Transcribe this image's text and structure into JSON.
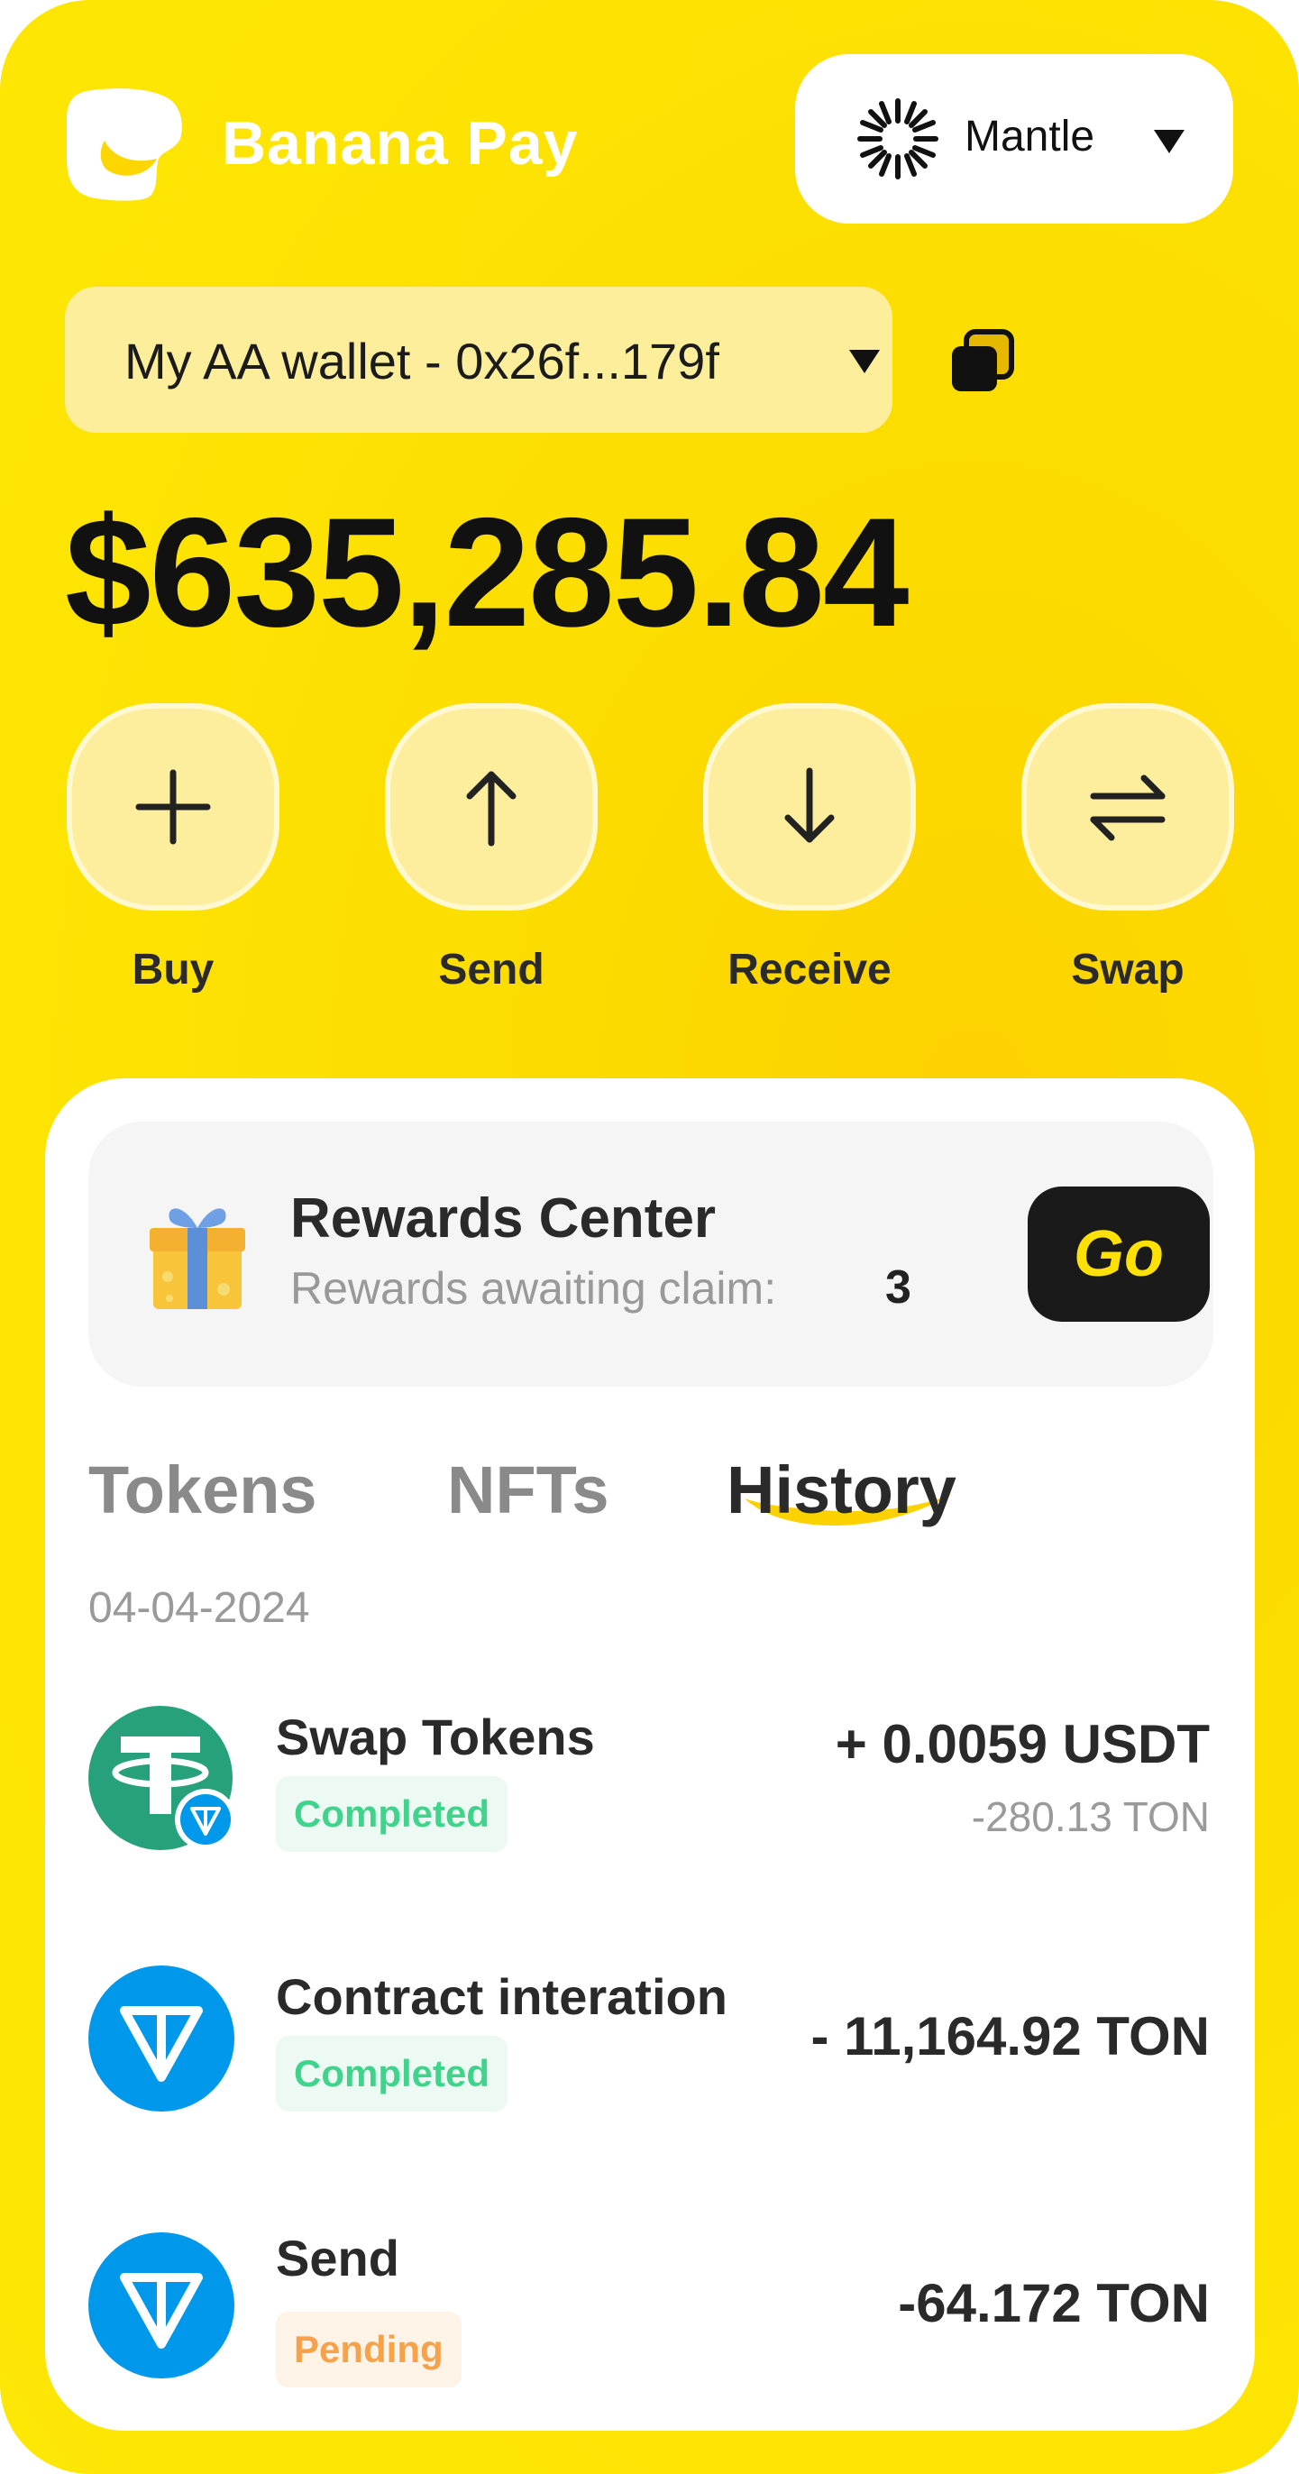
{
  "header": {
    "brand": "Banana Pay",
    "network": "Mantle",
    "wallet_label": "My AA wallet - 0x26f...179f"
  },
  "balance": "$635,285.84",
  "actions": [
    {
      "label": "Buy",
      "icon": "plus-icon"
    },
    {
      "label": "Send",
      "icon": "arrow-up-icon"
    },
    {
      "label": "Receive",
      "icon": "arrow-down-icon"
    },
    {
      "label": "Swap",
      "icon": "swap-arrows-icon"
    }
  ],
  "rewards": {
    "title": "Rewards Center",
    "subtitle": "Rewards awaiting claim:",
    "count": "3",
    "button": "Go"
  },
  "tabs": [
    "Tokens",
    "NFTs",
    "History"
  ],
  "active_tab": "History",
  "history": {
    "date": "04-04-2024",
    "items": [
      {
        "title": "Swap Tokens",
        "status": "Completed",
        "amount": "+ 0.0059 USDT",
        "subamount": "-280.13 TON",
        "icon": "usdt-ton-icon"
      },
      {
        "title": "Contract interation",
        "status": "Completed",
        "amount": "- 11,164.92 TON",
        "icon": "ton-icon"
      },
      {
        "title": "Send",
        "status": "Pending",
        "amount": "-64.172 TON",
        "icon": "ton-icon"
      }
    ]
  },
  "colors": {
    "brand_yellow": "#fde105",
    "completed": "#3fd38c",
    "pending": "#f5a24a",
    "ton_blue": "#0098ea",
    "usdt_green": "#26a17b"
  }
}
